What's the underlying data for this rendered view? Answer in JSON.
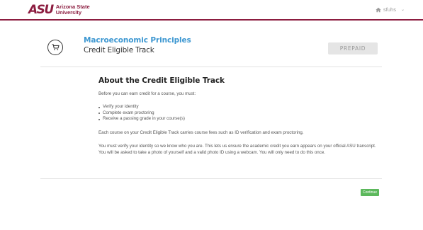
{
  "header": {
    "logo_mark": "ASU",
    "logo_line1": "Arizona State",
    "logo_line2": "University",
    "username": "sfuhs",
    "icons": {
      "home": "home-icon",
      "caret": "caret-down-icon"
    }
  },
  "course": {
    "title": "Macroeconomic Principles",
    "track": "Credit Eligible Track",
    "status_label": "PREPAID",
    "icon": "shopping-cart-icon"
  },
  "about": {
    "heading": "About the Credit Eligible Track",
    "intro": "Before you can earn credit for a course, you must:",
    "requirements": [
      "Verify your identity",
      "Complete exam proctoring",
      "Receive a passing grade in your course(s)"
    ],
    "fees": "Each course on your Credit Eligible Track carries course fees such as ID verification and exam proctoring.",
    "identity": "You must verify your identity so we know who you are. This lets us ensure the academic credit you earn appears on your official ASU transcript. You will be asked to take a photo of yourself and a valid photo ID using a webcam. You will only need to do this once."
  },
  "actions": {
    "continue_label": "Continue"
  },
  "colors": {
    "brand": "#8c1d40",
    "link": "#3d97d1",
    "success": "#5cb85c"
  }
}
